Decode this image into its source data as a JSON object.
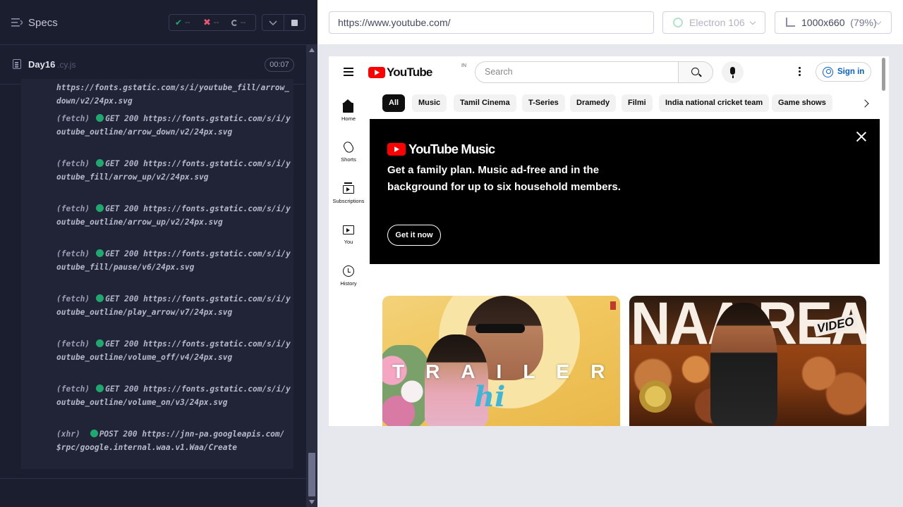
{
  "runner": {
    "specs_label": "Specs",
    "stats": {
      "passed": "--",
      "failed": "--",
      "pending": "--"
    },
    "spec": {
      "name": "Day16",
      "ext": ".cy.js",
      "timer": "00:07"
    },
    "log": [
      {
        "type": "",
        "method": "",
        "url": "https://fonts.gstatic.com/s/i/youtube_fill/arrow_down/v2/24px.svg",
        "continuation": true
      },
      {
        "type": "(fetch)",
        "method": "GET 200",
        "url": "https://fonts.gstatic.com/s/i/youtube_outline/arrow_down/v2/24px.svg"
      },
      {
        "type": "(fetch)",
        "method": "GET 200",
        "url": "https://fonts.gstatic.com/s/i/youtube_fill/arrow_up/v2/24px.svg"
      },
      {
        "type": "(fetch)",
        "method": "GET 200",
        "url": "https://fonts.gstatic.com/s/i/youtube_outline/arrow_up/v2/24px.svg"
      },
      {
        "type": "(fetch)",
        "method": "GET 200",
        "url": "https://fonts.gstatic.com/s/i/youtube_fill/pause/v6/24px.svg"
      },
      {
        "type": "(fetch)",
        "method": "GET 200",
        "url": "https://fonts.gstatic.com/s/i/youtube_outline/play_arrow/v7/24px.svg"
      },
      {
        "type": "(fetch)",
        "method": "GET 200",
        "url": "https://fonts.gstatic.com/s/i/youtube_outline/volume_off/v4/24px.svg"
      },
      {
        "type": "(fetch)",
        "method": "GET 200",
        "url": "https://fonts.gstatic.com/s/i/youtube_outline/volume_on/v3/24px.svg"
      },
      {
        "type": "(xhr)",
        "method": "POST 200",
        "url": "https://jnn-pa.googleapis.com/$rpc/google.internal.waa.v1.Waa/Create"
      }
    ]
  },
  "aut_header": {
    "url": "https://www.youtube.com/",
    "browser": "Electron 106",
    "viewport": "1000x660",
    "zoom": "(79%)"
  },
  "youtube": {
    "logo_text": "YouTube",
    "country_code": "IN",
    "search_placeholder": "Search",
    "sign_in": "Sign in",
    "nav": [
      {
        "label": "Home",
        "icon": "home-icon"
      },
      {
        "label": "Shorts",
        "icon": "shorts-icon"
      },
      {
        "label": "Subscriptions",
        "icon": "subscriptions-icon"
      },
      {
        "label": "You",
        "icon": "you-icon"
      },
      {
        "label": "History",
        "icon": "history-icon"
      }
    ],
    "chips": [
      "All",
      "Music",
      "Tamil Cinema",
      "T-Series",
      "Dramedy",
      "Filmi",
      "India national cricket team",
      "Game shows"
    ],
    "banner": {
      "logo_text": "YouTube Music",
      "headline": "Get a family plan. Music ad-free and in the background for up to six household members.",
      "cta": "Get it now"
    },
    "thumbnails": [
      {
        "overlay_text": "TRAILER",
        "script_text": "hi"
      },
      {
        "overlay_text": "NAA READY",
        "tag": "VIDEO"
      }
    ]
  },
  "colors": {
    "runner_bg": "#1b1e2e",
    "pass": "#1fa971",
    "fail": "#e45770",
    "youtube_red": "#ff0000",
    "link_blue": "#065fd4"
  }
}
